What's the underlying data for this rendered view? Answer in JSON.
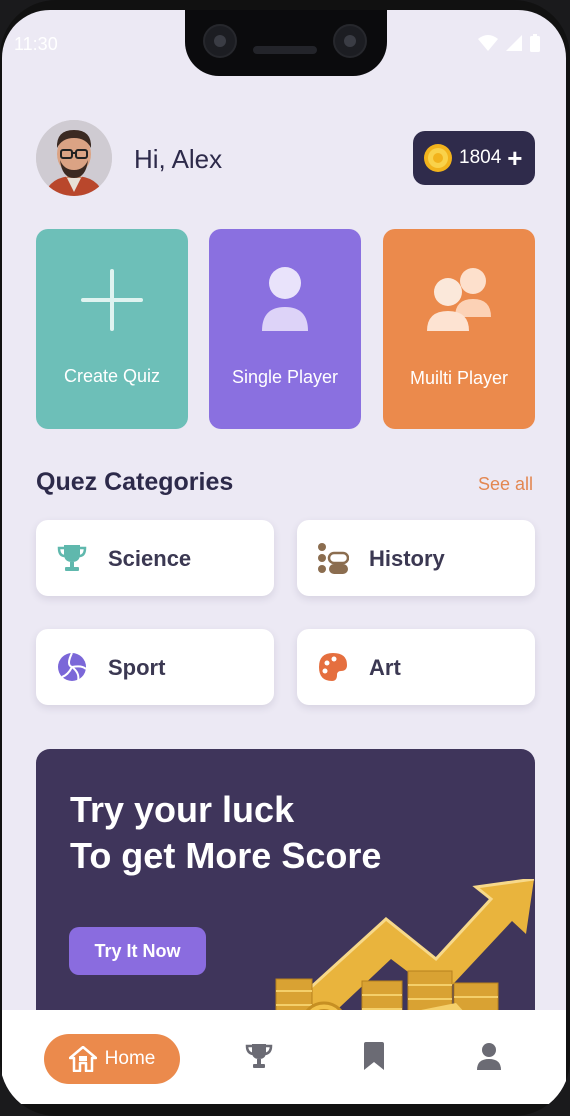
{
  "status_bar": {
    "time": "11:30"
  },
  "header": {
    "greeting": "Hi, Alex",
    "coins": "1804",
    "add_symbol": "+"
  },
  "modes": [
    {
      "label": "Create Quiz",
      "color": "#6dbfb8"
    },
    {
      "label": "Single Player",
      "color": "#8a70e0"
    },
    {
      "label": "Muilti Player",
      "color": "#eb8a4c"
    }
  ],
  "categories": {
    "title": "Quez Categories",
    "see_all": "See all",
    "items": [
      {
        "label": "Science",
        "icon": "trophy-icon"
      },
      {
        "label": "History",
        "icon": "timeline-icon"
      },
      {
        "label": "Sport",
        "icon": "volleyball-icon"
      },
      {
        "label": "Art",
        "icon": "palette-icon"
      }
    ]
  },
  "promo": {
    "line1": "Try your luck",
    "line2": "To get More Score",
    "button": "Try It Now"
  },
  "bottom_nav": {
    "home_label": "Home",
    "items": [
      "home-icon",
      "trophy-icon",
      "bookmark-icon",
      "profile-icon"
    ]
  },
  "colors": {
    "accent": "#eb8a4c",
    "dark": "#2f2b4b",
    "background": "#ece9f4"
  }
}
